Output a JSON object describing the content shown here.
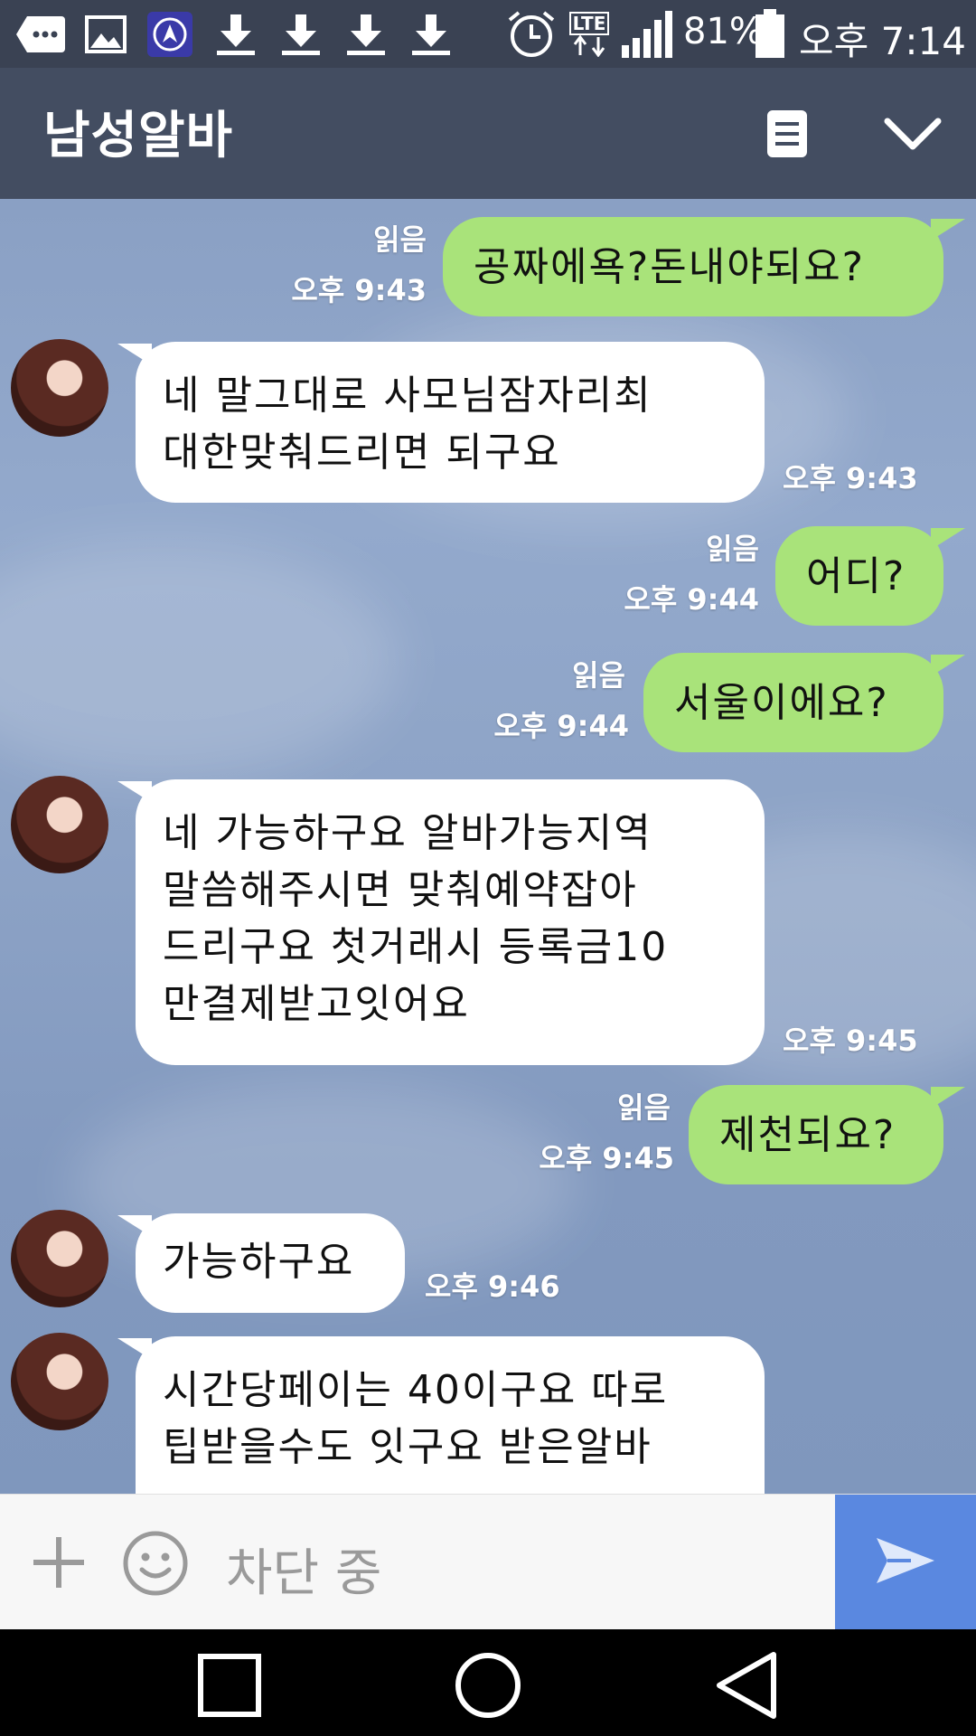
{
  "status_bar": {
    "battery": "81%",
    "time": "오후 7:14",
    "network": "LTE",
    "icons": [
      "chat-icon",
      "image-icon",
      "app-icon",
      "download-icon",
      "download-icon",
      "download-icon",
      "download-icon",
      "alarm-icon",
      "lte-icon",
      "signal-icon",
      "battery-icon"
    ]
  },
  "header": {
    "title": "남성알바",
    "icons": [
      "menu-icon",
      "chevron-down-icon"
    ]
  },
  "messages": [
    {
      "side": "out",
      "text": "공짜에욕?돈내야되요?",
      "read": "읽음",
      "time": "오후 9:43"
    },
    {
      "side": "in",
      "text": "네 말그대로 사모님잠자리최\n대한맞춰드리면 되구요",
      "time": "오후 9:43"
    },
    {
      "side": "out",
      "text": "어디?",
      "read": "읽음",
      "time": "오후 9:44"
    },
    {
      "side": "out",
      "text": "서울이에요?",
      "read": "읽음",
      "time": "오후 9:44"
    },
    {
      "side": "in",
      "text": "네 가능하구요 알바가능지역\n말씀해주시면 맞춰예약잡아\n드리구요 첫거래시 등록금10\n만결제받고잇어요",
      "time": "오후 9:45"
    },
    {
      "side": "out",
      "text": "제천되요?",
      "read": "읽음",
      "time": "오후 9:45"
    },
    {
      "side": "in",
      "text": "가능하구요",
      "time": "오후 9:46"
    },
    {
      "side": "in",
      "text": "시간당페이는 40이구요 따로\n팁받을수도 잇구요 받은알바",
      "time": ""
    }
  ],
  "input": {
    "placeholder": "차단 중",
    "icons": [
      "plus-icon",
      "emoji-icon",
      "send-icon"
    ]
  },
  "nav": {
    "icons": [
      "recent-apps-icon",
      "home-icon",
      "back-icon"
    ]
  },
  "colors": {
    "outgoing_bubble": "#a9e37a",
    "incoming_bubble": "#ffffff",
    "header": "#434d61",
    "send_button": "#5a88e0"
  }
}
